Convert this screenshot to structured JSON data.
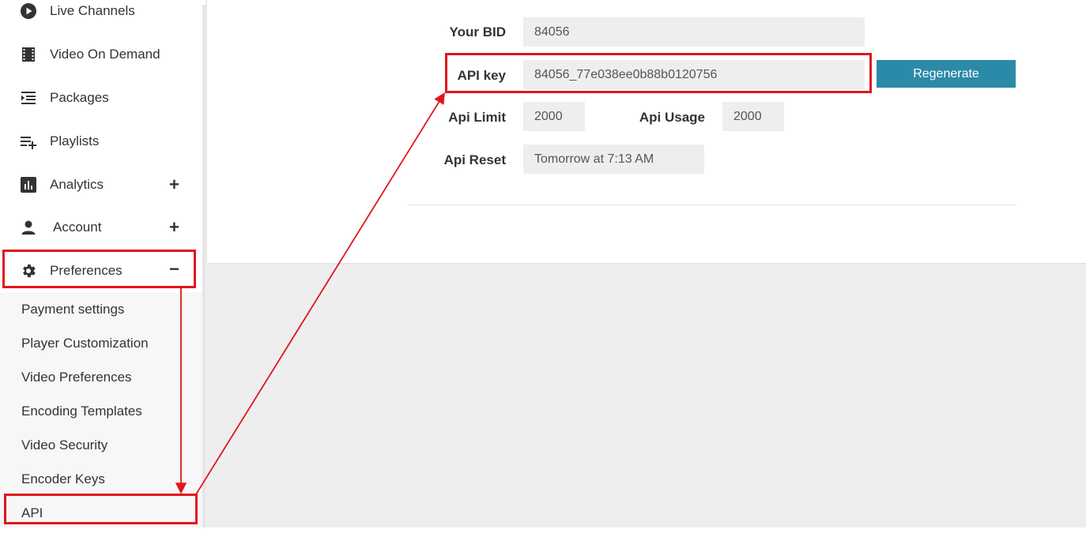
{
  "sidebar": {
    "items": [
      {
        "label": "Live Channels",
        "icon": "play-circle-icon"
      },
      {
        "label": "Video On Demand",
        "icon": "film-icon"
      },
      {
        "label": "Packages",
        "icon": "indent-list-icon"
      },
      {
        "label": "Playlists",
        "icon": "playlist-add-icon"
      },
      {
        "label": "Analytics",
        "icon": "bar-chart-icon",
        "toggle": "+"
      },
      {
        "label": "Account",
        "icon": "person-icon",
        "toggle": "+"
      },
      {
        "label": "Preferences",
        "icon": "gear-icon",
        "toggle": "−"
      }
    ],
    "submenu": [
      {
        "label": "Payment settings"
      },
      {
        "label": "Player Customization"
      },
      {
        "label": "Video Preferences"
      },
      {
        "label": "Encoding Templates"
      },
      {
        "label": "Video Security"
      },
      {
        "label": "Encoder Keys"
      },
      {
        "label": "API"
      }
    ]
  },
  "api_panel": {
    "bid_label": "Your BID",
    "bid_value": "84056",
    "key_label": "API key",
    "key_value": "84056_77e038ee0b88b0120756",
    "regenerate_label": "Regenerate",
    "limit_label": "Api Limit",
    "limit_value": "2000",
    "usage_label": "Api Usage",
    "usage_value": "2000",
    "reset_label": "Api Reset",
    "reset_value": "Tomorrow at 7:13 AM"
  },
  "colors": {
    "accent": "#2b8aa8",
    "annotation_red": "#e0161e"
  }
}
